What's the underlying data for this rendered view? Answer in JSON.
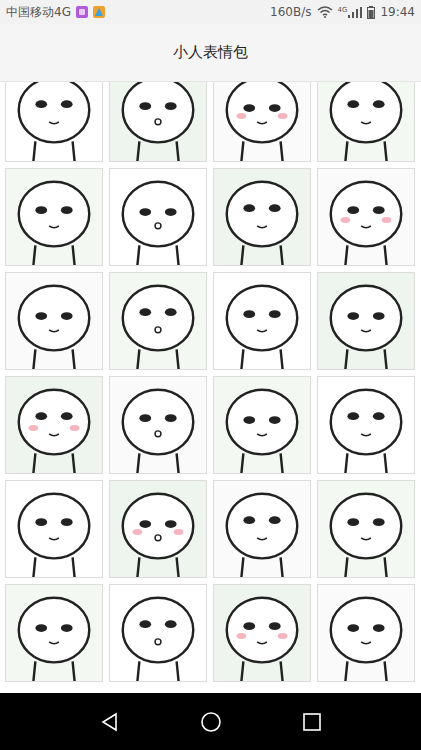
{
  "status_bar": {
    "carrier": "中国移动4G",
    "speed": "160B/s",
    "network": "4G",
    "time": "19:44"
  },
  "title": "小人表情包"
}
